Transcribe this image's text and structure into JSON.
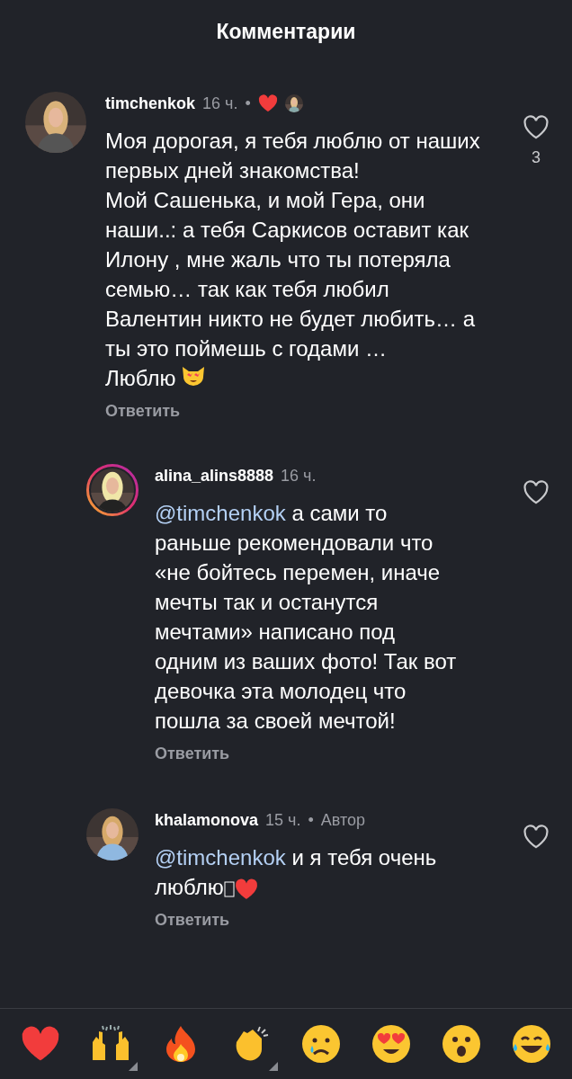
{
  "header": {
    "title": "Комментарии"
  },
  "comment": {
    "username": "timchenkok",
    "time": "16 ч.",
    "separator": "•",
    "liked_by_author": true,
    "text": "Моя дорогая, я тебя люблю от наших первых дней знакомства!\nМой Сашенька, и мой Гера, они наши..: а тебя Саркисов оставит как  Илону , мне жаль что ты потеряла семью… так как тебя любил Валентин никто не будет любить… а ты это поймешь с годами …\nЛюблю",
    "end_emoji": {
      "kind": "cat"
    },
    "likes": "3",
    "reply": "Ответить"
  },
  "replies": [
    {
      "username": "alina_alins8888",
      "time": "16 ч.",
      "story_ring": true,
      "mention": "@timchenkok",
      "text": " а сами то раньше рекомендовали что «не бойтесь перемен, иначе мечты так и останутся мечтами» написано под одним из ваших фото! Так вот девочка эта молодец что пошла за своей мечтой!",
      "reply": "Ответить"
    },
    {
      "username": "khalamonova",
      "time": "15 ч.",
      "separator": "•",
      "badge": "Автор",
      "story_ring": false,
      "mention": "@timchenkok",
      "text": " и я тебя очень люблю",
      "end_emoji": {
        "kind": "heart"
      },
      "reply": "Ответить"
    }
  ],
  "reactions": [
    {
      "kind": "heart",
      "variants": false
    },
    {
      "kind": "hands",
      "variants": true
    },
    {
      "kind": "fire",
      "variants": false
    },
    {
      "kind": "clap",
      "variants": true
    },
    {
      "kind": "sad",
      "variants": false
    },
    {
      "kind": "love",
      "variants": false
    },
    {
      "kind": "wow",
      "variants": false
    },
    {
      "kind": "laugh",
      "variants": false
    }
  ]
}
